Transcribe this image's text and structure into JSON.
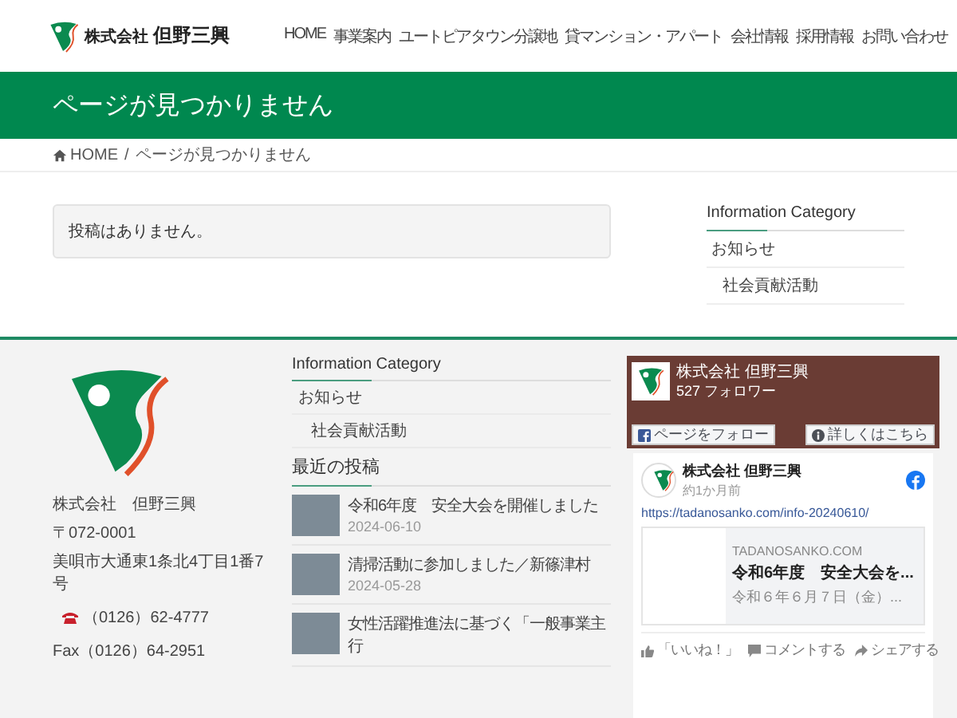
{
  "header": {
    "logo_small": "株式会社",
    "logo_name": "但野三興",
    "nav": [
      {
        "label": "HOME"
      },
      {
        "label": "事業案内"
      },
      {
        "label": "ユートピアタウン分譲地"
      },
      {
        "label": "貸マンション・アパート"
      },
      {
        "label": "会社情報"
      },
      {
        "label": "採用情報"
      },
      {
        "label": "お問い合わせ"
      }
    ]
  },
  "page_title": "ページが見つかりません",
  "breadcrumb": {
    "separator": "/",
    "items": [
      {
        "label": "HOME",
        "kind": "home"
      },
      {
        "label": "ページが見つかりません",
        "kind": "current"
      }
    ]
  },
  "notice": "投稿はありません。",
  "sidebar": {
    "title": "Information Category",
    "items": [
      {
        "label": "お知らせ",
        "children": [
          {
            "label": "社会貢献活動"
          }
        ]
      }
    ]
  },
  "footer": {
    "company": "株式会社　但野三興",
    "postal": "〒072-0001",
    "address": "美唄市大通東1条北4丁目1番7号",
    "phone": "（0126）62-4777",
    "fax": "Fax（0126）64-2951",
    "categories": {
      "title": "Information Category",
      "items": [
        {
          "label": "お知らせ",
          "children": [
            {
              "label": "社会貢献活動"
            }
          ]
        }
      ]
    },
    "recent": {
      "title": "最近の投稿",
      "posts": [
        {
          "title": "令和6年度　安全大会を開催しました",
          "date": "2024-06-10"
        },
        {
          "title": "清掃活動に参加しました／新篠津村",
          "date": "2024-05-28"
        },
        {
          "title": "女性活躍推進法に基づく「一般事業主行"
        }
      ]
    },
    "facebook": {
      "page_name": "株式会社 但野三興",
      "followers": "527 フォロワー",
      "follow_button": "ページをフォロー",
      "more_button": "詳しくはこちら",
      "post": {
        "author": "株式会社 但野三興",
        "time": "約1か月前",
        "link": "https://tadanosanko.com/info-20240610/",
        "preview": {
          "domain": "TADANOSANKO.COM",
          "title": "令和6年度　安全大会を...",
          "description": "令和６年６月７日（金）..."
        }
      },
      "actions": [
        {
          "label": "「いいね！」",
          "kind": "like"
        },
        {
          "label": "コメントする",
          "kind": "comment"
        },
        {
          "label": "シェアする",
          "kind": "share"
        }
      ]
    }
  }
}
